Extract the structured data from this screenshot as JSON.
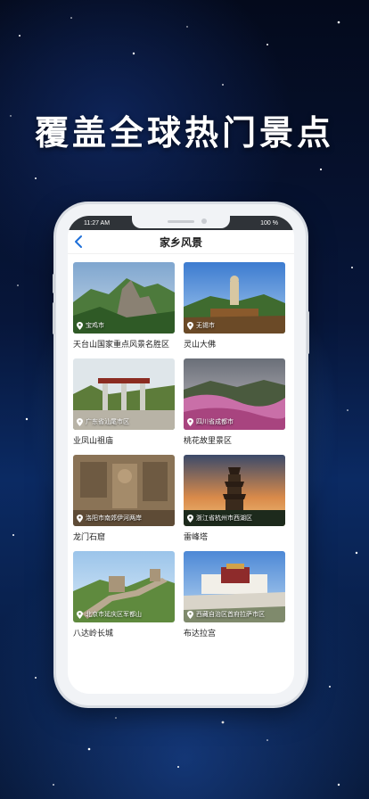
{
  "colors": {
    "accent": "#1e6fd9",
    "title": "#ffffff"
  },
  "headline": "覆盖全球热门景点",
  "status": {
    "time": "11:27 AM",
    "battery": "100 %"
  },
  "navbar": {
    "back_icon": "chevron-left-icon",
    "title": "家乡风景"
  },
  "spots": [
    {
      "name": "天台山国家重点风景名胜区",
      "location": "宝鸡市"
    },
    {
      "name": "灵山大佛",
      "location": "无锡市"
    },
    {
      "name": "业凤山祖庙",
      "location": "广东省汕尾市区"
    },
    {
      "name": "桃花故里景区",
      "location": "四川省成都市"
    },
    {
      "name": "龙门石窟",
      "location": "洛阳市南郊伊河两岸"
    },
    {
      "name": "雷峰塔",
      "location": "浙江省杭州市西湖区"
    },
    {
      "name": "八达岭长城",
      "location": "北京市延庆区军都山"
    },
    {
      "name": "布达拉宫",
      "location": "西藏自治区首府拉萨市区"
    }
  ]
}
